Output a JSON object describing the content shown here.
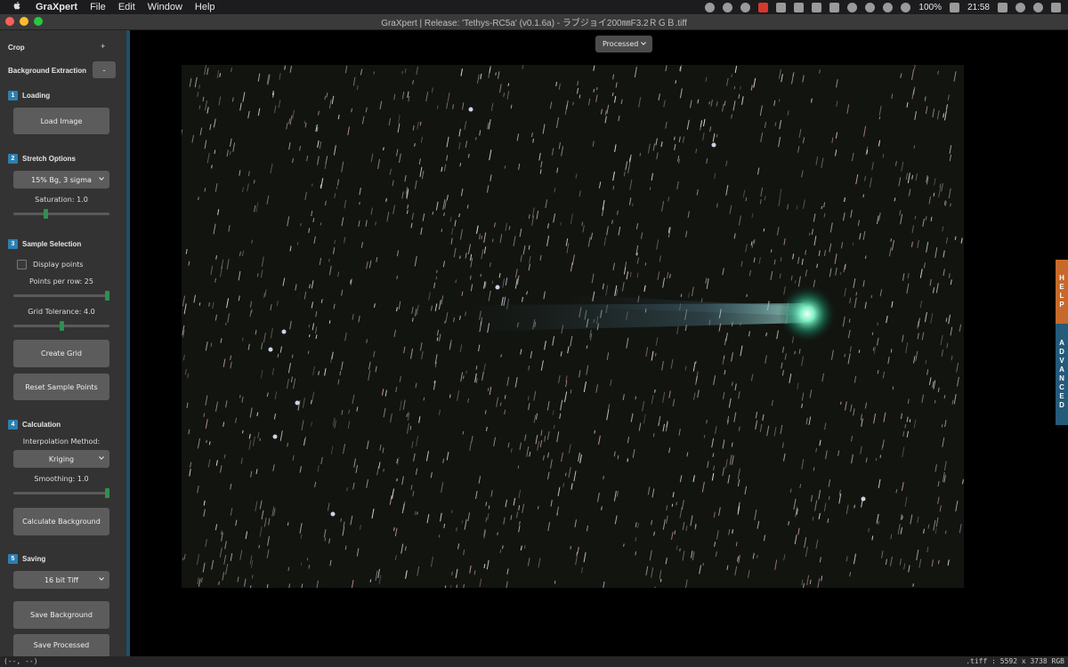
{
  "menubar": {
    "app_name": "GraXpert",
    "menus": [
      "File",
      "Edit",
      "Window",
      "Help"
    ],
    "battery": "100%",
    "clock": "21:58"
  },
  "window": {
    "title": "GraXpert | Release: 'Tethys-RC5a' (v0.1.6a) - ラブジョイ200㎜F3.2ＲＧＢ.tiff"
  },
  "sidebar": {
    "crop": {
      "label": "Crop",
      "toggle": "+"
    },
    "background_extraction": {
      "label": "Background Extraction",
      "toggle": "-"
    },
    "loading": {
      "num": "1",
      "title": "Loading",
      "load_button": "Load Image"
    },
    "stretch": {
      "num": "2",
      "title": "Stretch Options",
      "mode": "15% Bg, 3 sigma",
      "saturation_label": "Saturation: 1.0",
      "saturation": 0.33
    },
    "sample": {
      "num": "3",
      "title": "Sample Selection",
      "display_points": "Display points",
      "points_label": "Points per row: 25",
      "points": 1.0,
      "tolerance_label": "Grid Tolerance: 4.0",
      "tolerance": 0.5,
      "create_grid": "Create Grid",
      "reset": "Reset Sample Points"
    },
    "calculation": {
      "num": "4",
      "title": "Calculation",
      "method_label": "Interpolation Method:",
      "method": "Kriging",
      "smoothing_label": "Smoothing: 1.0",
      "smoothing": 1.0,
      "calculate": "Calculate Background"
    },
    "saving": {
      "num": "5",
      "title": "Saving",
      "format": "16 bit Tiff",
      "save_background": "Save Background",
      "save_processed": "Save Processed"
    }
  },
  "canvas": {
    "view_mode": "Processed"
  },
  "side_tabs": {
    "help": [
      "H",
      "E",
      "L",
      "P"
    ],
    "advanced": [
      "A",
      "D",
      "V",
      "A",
      "N",
      "C",
      "E",
      "D"
    ]
  },
  "status": {
    "coords": "(--, --)",
    "info": ".tiff : 5592 x 3738 RGB"
  },
  "colors": {
    "accent": "#2d7fb0",
    "slider": "#2f8f50",
    "help": "#c7692a",
    "advanced": "#245a7a"
  }
}
